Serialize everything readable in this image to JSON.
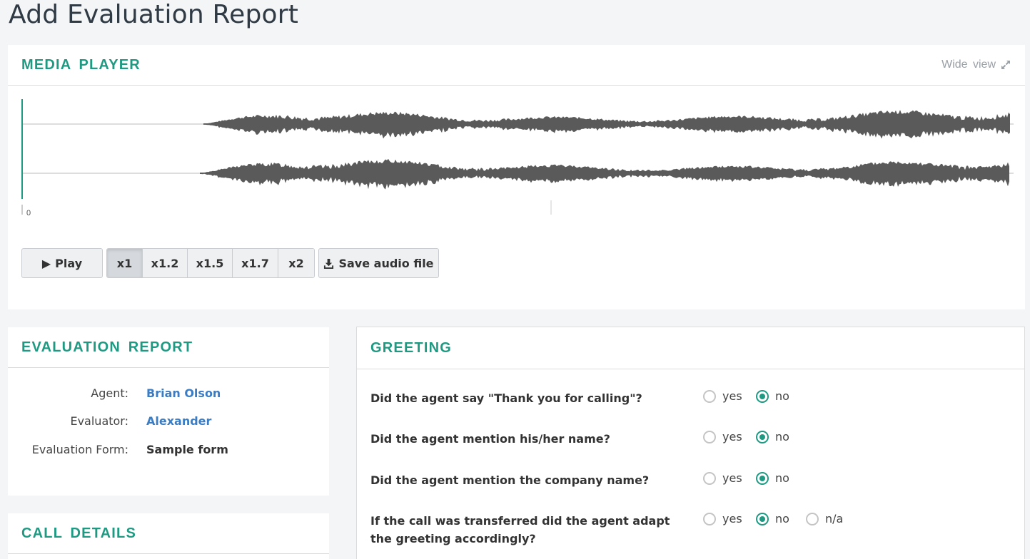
{
  "page_title": "Add Evaluation Report",
  "colors": {
    "accent": "#1f9a82",
    "link": "#3a7dc4",
    "waveform": "#555555"
  },
  "media_player": {
    "title": "MEDIA PLAYER",
    "wide_view_label": "Wide view",
    "timeline_start": "0",
    "play_label": "Play",
    "speeds": [
      "x1",
      "x1.2",
      "x1.5",
      "x1.7",
      "x2"
    ],
    "active_speed": "x1",
    "save_label": "Save audio file"
  },
  "evaluation_report": {
    "title": "EVALUATION REPORT",
    "agent_label": "Agent:",
    "agent_value": "Brian Olson",
    "evaluator_label": "Evaluator:",
    "evaluator_value": "Alexander",
    "form_label": "Evaluation Form:",
    "form_value": "Sample form"
  },
  "call_details": {
    "title": "CALL DETAILS"
  },
  "greeting": {
    "title": "GREETING",
    "questions": [
      {
        "text": "Did the agent say \"Thank you for calling\"?",
        "options": [
          "yes",
          "no"
        ],
        "selected": "no"
      },
      {
        "text": "Did the agent mention his/her name?",
        "options": [
          "yes",
          "no"
        ],
        "selected": "no"
      },
      {
        "text": "Did the agent mention the company name?",
        "options": [
          "yes",
          "no"
        ],
        "selected": "no"
      },
      {
        "text": "If the call was transferred did the agent adapt the greeting accordingly?",
        "options": [
          "yes",
          "no",
          "n/a"
        ],
        "selected": "no"
      }
    ]
  }
}
